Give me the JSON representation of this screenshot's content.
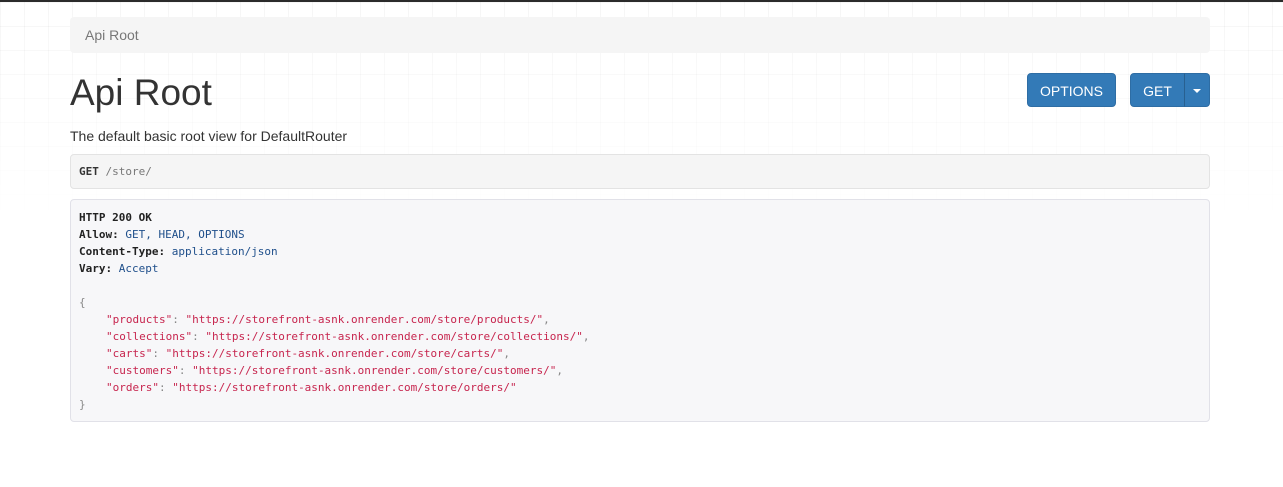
{
  "breadcrumb": {
    "current": "Api Root"
  },
  "header": {
    "title": "Api Root",
    "options_label": "OPTIONS",
    "get_label": "GET"
  },
  "description": "The default basic root view for DefaultRouter",
  "request": {
    "method": "GET",
    "path": "/store/"
  },
  "response": {
    "status": "HTTP 200 OK",
    "headers": [
      {
        "name": "Allow:",
        "value": "GET, HEAD, OPTIONS"
      },
      {
        "name": "Content-Type:",
        "value": "application/json"
      },
      {
        "name": "Vary:",
        "value": "Accept"
      }
    ],
    "open_brace": "{",
    "close_brace": "}",
    "body": [
      {
        "key": "\"products\"",
        "value": "\"https://storefront-asnk.onrender.com/store/products/\"",
        "sep": ","
      },
      {
        "key": "\"collections\"",
        "value": "\"https://storefront-asnk.onrender.com/store/collections/\"",
        "sep": ","
      },
      {
        "key": "\"carts\"",
        "value": "\"https://storefront-asnk.onrender.com/store/carts/\"",
        "sep": ","
      },
      {
        "key": "\"customers\"",
        "value": "\"https://storefront-asnk.onrender.com/store/customers/\"",
        "sep": ","
      },
      {
        "key": "\"orders\"",
        "value": "\"https://storefront-asnk.onrender.com/store/orders/\"",
        "sep": ""
      }
    ]
  },
  "colors": {
    "primary_button": "#337ab7",
    "json_string": "#c7254e",
    "header_value": "#1f4f8b"
  },
  "icons": {
    "dropdown": "caret-down-icon"
  }
}
